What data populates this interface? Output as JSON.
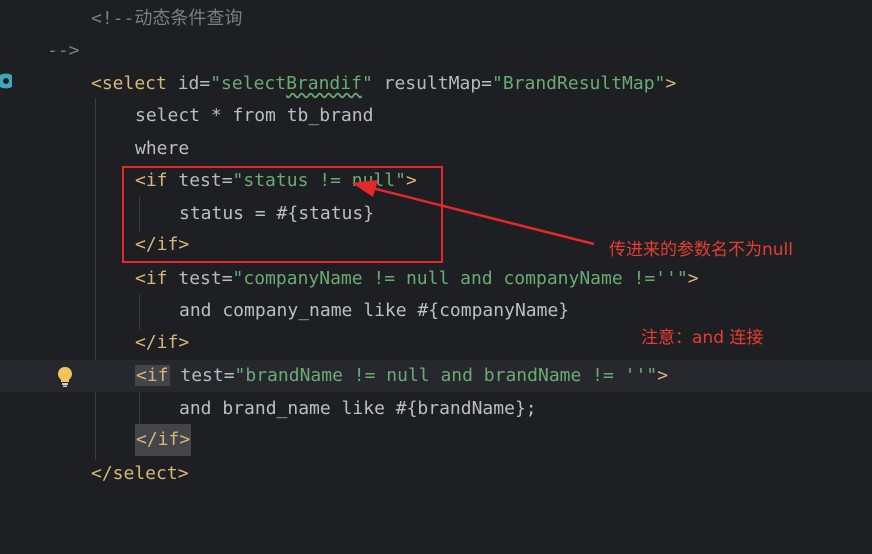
{
  "editor": {
    "lines": {
      "l0": {
        "comment": "<!--动态条件查询"
      },
      "l1": {
        "comment": "-->"
      },
      "l2": {
        "open": "<select",
        "attr1": " id",
        "eq1": "=",
        "val1a": "\"select",
        "val1b": "Brandif",
        "val1c": "\"",
        "attr2": " resultMap",
        "eq2": "=",
        "val2": "\"BrandResultMap\"",
        "close": ">"
      },
      "l3": {
        "text": "select * from tb_brand"
      },
      "l4": {
        "text": "where"
      },
      "l5": {
        "open": "<if",
        "attr": " test",
        "eq": "=",
        "val": "\"status != null\"",
        "close": ">"
      },
      "l6": {
        "text": "status = #{status}"
      },
      "l7": {
        "tag": "</if>"
      },
      "l8": {
        "open": "<if",
        "attr": " test",
        "eq": "=",
        "val": "\"companyName != null and companyName !=''\"",
        "close": ">"
      },
      "l9": {
        "text": "and company_name like #{companyName}"
      },
      "l10": {
        "tag": "</if>"
      },
      "l11": {
        "open": "<if",
        "attr": " test",
        "eq": "=",
        "val": "\"brandName != null and brandName != ''\"",
        "close": ">"
      },
      "l12": {
        "text": "and brand_name like #{brandName};"
      },
      "l13": {
        "tag": "</if>"
      },
      "l14": {
        "tag": "</select>"
      }
    }
  },
  "annotations": {
    "note1": "传进来的参数名不为null",
    "note2": "注意：and 连接"
  },
  "colors": {
    "background": "#1e1f22",
    "tag": "#d5b778",
    "string": "#6aab73",
    "comment": "#7a7e85",
    "annotation": "#e5282c"
  },
  "icons": {
    "gutter": "bookmark-icon",
    "intention": "lightbulb-icon"
  }
}
